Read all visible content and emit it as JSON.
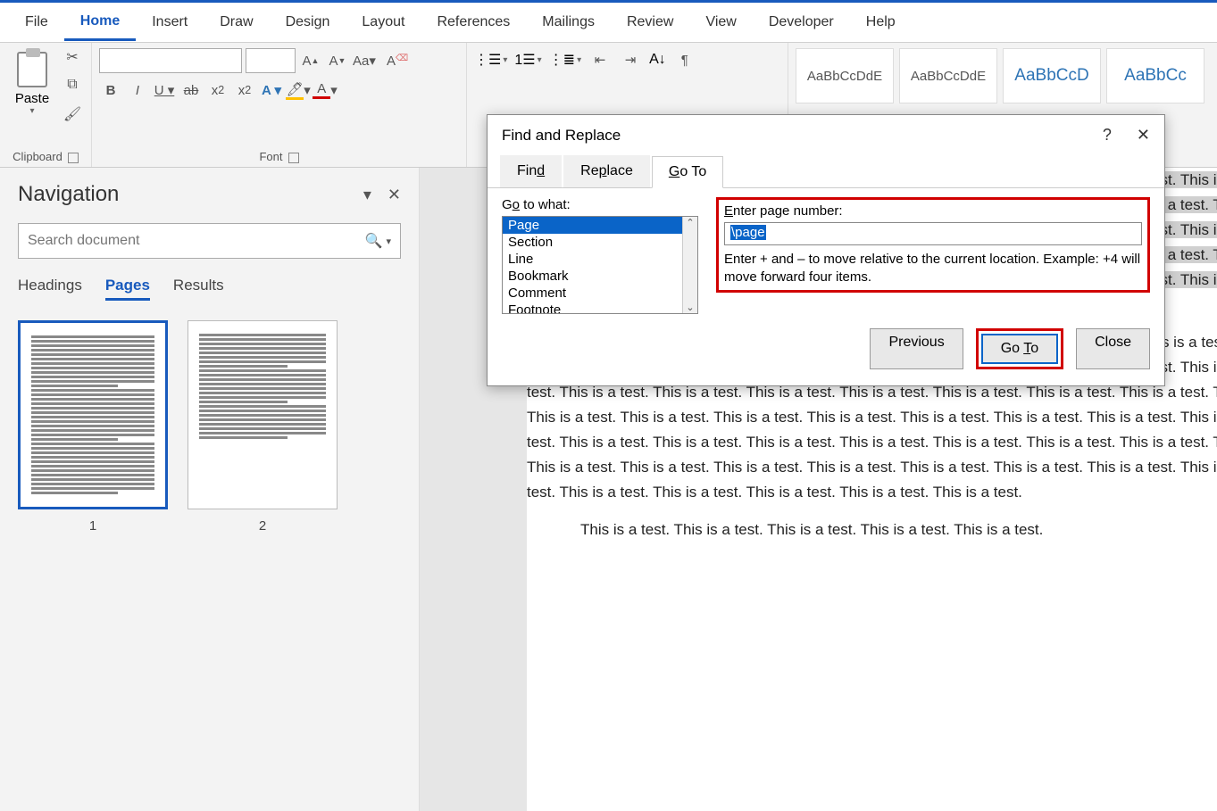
{
  "tabs": {
    "file": "File",
    "home": "Home",
    "insert": "Insert",
    "draw": "Draw",
    "design": "Design",
    "layout": "Layout",
    "references": "References",
    "mailings": "Mailings",
    "review": "Review",
    "view": "View",
    "developer": "Developer",
    "help": "Help"
  },
  "ribbon": {
    "clipboard": {
      "label": "Clipboard",
      "paste": "Paste"
    },
    "font": {
      "label": "Font"
    },
    "styles": {
      "items": [
        "AaBbCcDdE",
        "AaBbCcDdE",
        "AaBbCcD",
        "AaBbCc"
      ]
    }
  },
  "nav": {
    "title": "Navigation",
    "search_placeholder": "Search document",
    "tabs": {
      "headings": "Headings",
      "pages": "Pages",
      "results": "Results"
    },
    "thumb1_num": "1",
    "thumb2_num": "2"
  },
  "dialog": {
    "title": "Find and Replace",
    "tabs": {
      "find": "Find",
      "replace": "Replace",
      "goto": "Go To"
    },
    "goto_what_label": "Go to what:",
    "goto_items": [
      "Page",
      "Section",
      "Line",
      "Bookmark",
      "Comment",
      "Footnote"
    ],
    "enter_label": "Enter page number:",
    "enter_value": "\\page",
    "hint": "Enter + and – to move relative to the current location. Example: +4 will move forward four items.",
    "buttons": {
      "previous": "Previous",
      "goto": "Go To",
      "close": "Close"
    }
  },
  "doc": {
    "test_phrase": "This is a test. "
  }
}
